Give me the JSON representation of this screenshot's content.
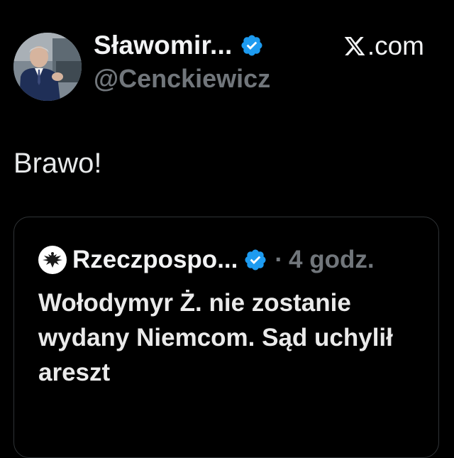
{
  "post": {
    "author_name": "Sławomir...",
    "author_handle": "@Cenckiewicz",
    "source_label": ".com",
    "text": "Brawo!"
  },
  "quoted_post": {
    "author_name": "Rzeczpospo...",
    "separator": "·",
    "time": "4 godz.",
    "text": "Wołodymyr Ż. nie zostanie wydany Niemcom. Sąd uchylił areszt"
  },
  "colors": {
    "background": "#000000",
    "primary_text": "#e7e9ea",
    "secondary_text": "#71767b",
    "verified_blue": "#1d9bf0",
    "card_border": "#2f3336"
  },
  "icons": {
    "avatar": "profile-photo",
    "verified": "verified-badge-icon",
    "x_logo": "x-logo-icon",
    "quote_avatar": "eagle-logo-icon"
  }
}
